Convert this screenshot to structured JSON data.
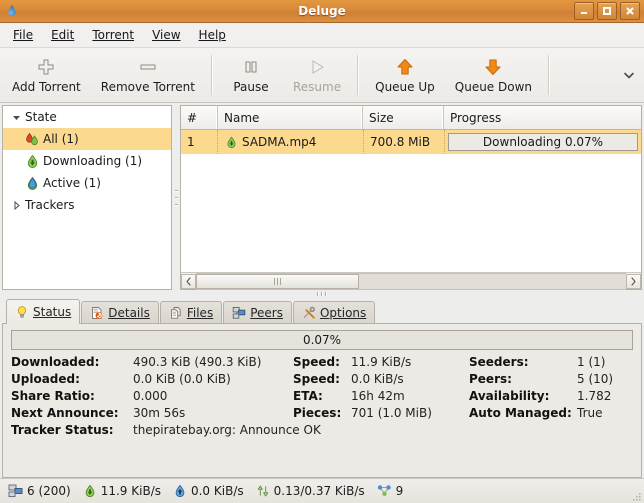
{
  "window": {
    "title": "Deluge",
    "minimize_label": "Minimize",
    "maximize_label": "Maximize",
    "close_label": "Close",
    "app_icon": "deluge-droplet-icon"
  },
  "menubar": {
    "items": [
      {
        "label": "File",
        "mnemonic": "F"
      },
      {
        "label": "Edit",
        "mnemonic": "E"
      },
      {
        "label": "Torrent",
        "mnemonic": "T"
      },
      {
        "label": "View",
        "mnemonic": "V"
      },
      {
        "label": "Help",
        "mnemonic": "H"
      }
    ]
  },
  "toolbar": {
    "buttons": [
      {
        "label": "Add Torrent",
        "icon": "plus-icon",
        "enabled": true
      },
      {
        "label": "Remove Torrent",
        "icon": "minus-icon",
        "enabled": true
      },
      {
        "label": "Pause",
        "icon": "pause-icon",
        "enabled": true
      },
      {
        "label": "Resume",
        "icon": "play-icon",
        "enabled": false
      },
      {
        "label": "Queue Up",
        "icon": "arrow-up-icon",
        "enabled": true
      },
      {
        "label": "Queue Down",
        "icon": "arrow-down-icon",
        "enabled": true
      }
    ],
    "overflow_icon": "chevron-down-icon"
  },
  "sidebar": {
    "header": {
      "label": "State",
      "expander": "triangle-down-icon"
    },
    "items": [
      {
        "label": "All (1)",
        "icon": "all-torrents-icon",
        "selected": true
      },
      {
        "label": "Downloading (1)",
        "icon": "download-arrow-icon",
        "selected": false
      },
      {
        "label": "Active (1)",
        "icon": "active-droplet-icon",
        "selected": false
      }
    ],
    "trackers": {
      "label": "Trackers",
      "expander": "triangle-right-icon"
    }
  },
  "torrent_list": {
    "columns": [
      "#",
      "Name",
      "Size",
      "Progress"
    ],
    "rows": [
      {
        "num": "1",
        "name": "SADMA.mp4",
        "name_icon": "download-arrow-icon",
        "size": "700.8 MiB",
        "progress_text": "Downloading 0.07%",
        "progress_percent": 0.07,
        "selected": true
      }
    ],
    "scrollbar": {
      "left_arrow": "chevron-left-icon",
      "right_arrow": "chevron-right-icon"
    }
  },
  "details_tabs": {
    "tabs": [
      {
        "label": "Status",
        "mnemonic": "S",
        "icon": "lightbulb-icon",
        "active": true
      },
      {
        "label": "Details",
        "mnemonic": "D",
        "icon": "page-wrench-icon",
        "active": false
      },
      {
        "label": "Files",
        "mnemonic": "F",
        "icon": "files-icon",
        "active": false
      },
      {
        "label": "Peers",
        "mnemonic": "P",
        "icon": "network-computers-icon",
        "active": false
      },
      {
        "label": "Options",
        "mnemonic": "O",
        "icon": "tools-icon",
        "active": false
      }
    ]
  },
  "status_panel": {
    "progress_text": "0.07%",
    "progress_percent": 0.07,
    "fields": [
      {
        "label": "Downloaded:",
        "value": "490.3 KiB (490.3 KiB)"
      },
      {
        "label": "Speed:",
        "value": "11.9 KiB/s"
      },
      {
        "label": "Seeders:",
        "value": "1 (1)"
      },
      {
        "label": "Uploaded:",
        "value": "0.0 KiB (0.0 KiB)"
      },
      {
        "label": "Speed:",
        "value": "0.0 KiB/s"
      },
      {
        "label": "Peers:",
        "value": "5 (10)"
      },
      {
        "label": "Share Ratio:",
        "value": "0.000"
      },
      {
        "label": "ETA:",
        "value": "16h 42m"
      },
      {
        "label": "Availability:",
        "value": "1.782"
      },
      {
        "label": "Next Announce:",
        "value": "30m 56s"
      },
      {
        "label": "Pieces:",
        "value": "701 (1.0 MiB)"
      },
      {
        "label": "Auto Managed:",
        "value": "True"
      }
    ],
    "tracker_status": {
      "label": "Tracker Status:",
      "value": "thepiratebay.org: Announce OK"
    }
  },
  "statusbar": {
    "connections": {
      "icon": "network-computers-icon",
      "value": "6 (200)"
    },
    "download_speed": {
      "icon": "download-arrow-icon",
      "value": "11.9 KiB/s"
    },
    "upload_speed": {
      "icon": "upload-arrow-icon",
      "value": "0.0 KiB/s"
    },
    "protocol_traffic": {
      "icon": "updown-arrow-icon",
      "value": "0.13/0.37 KiB/s"
    },
    "dht_nodes": {
      "icon": "dht-nodes-icon",
      "value": "9"
    }
  },
  "colors": {
    "titlebar": "#d8883a",
    "selection": "#fbd98f",
    "accent_orange": "#e8820c",
    "panel_bg": "#eceae4"
  }
}
